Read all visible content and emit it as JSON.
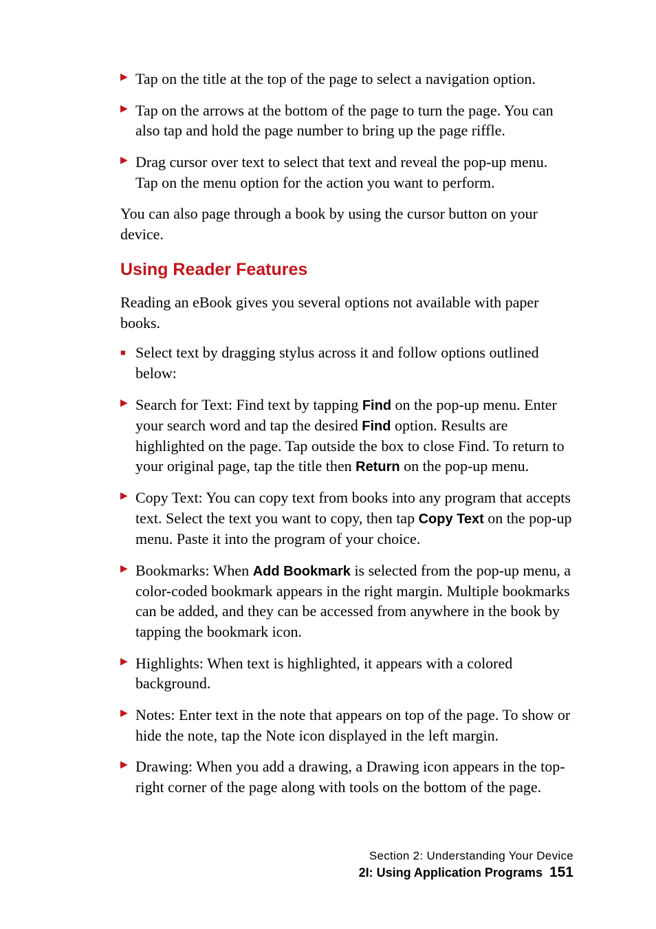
{
  "bullets_top": [
    "Tap on the title at the top of the page to select a navigation option.",
    "Tap on the arrows at the bottom of the page to turn the page. You can also tap and hold the page number to bring up the page riffle.",
    "Drag cursor over text to select that text and reveal the pop-up menu. Tap on the menu option for the action you want to perform."
  ],
  "para_after_top": "You can also page through a book by using the cursor button on your device.",
  "section_heading": "Using Reader Features",
  "intro_para": "Reading an eBook gives you several options not available with paper books.",
  "square_bullet": "Select text by dragging stylus across it and follow options outlined below:",
  "feature_bullets": {
    "search": {
      "pre1": "Search for Text: Find text by tapping ",
      "b1": "Find",
      "mid1": " on the pop-up menu. Enter your search word and tap the desired ",
      "b2": "Find",
      "mid2": " option. Results are highlighted on the page. Tap outside the box to close Find. To return to your original page, tap the title then ",
      "b3": "Return",
      "post": " on the pop-up menu."
    },
    "copy": {
      "pre": "Copy Text: You can copy text from books into any program that accepts text. Select the text you want to copy, then tap ",
      "b1": "Copy Text",
      "post": " on the pop-up menu. Paste it into the program of your choice."
    },
    "bookmarks": {
      "pre": "Bookmarks: When ",
      "b1": "Add Bookmark",
      "post": " is selected from the pop-up menu, a color-coded bookmark appears in the right margin. Multiple bookmarks can be added, and they can be accessed from anywhere in the book by tapping the bookmark icon."
    },
    "highlights": "Highlights: When text is highlighted, it appears with a colored background.",
    "notes": "Notes: Enter text in the note that appears on top of the page. To show or hide the note, tap the Note icon displayed in the left margin.",
    "drawing": "Drawing: When you add a drawing, a Drawing icon appears in the top-right corner of the page along with tools on the bottom of the page."
  },
  "footer": {
    "line1": "Section 2: Understanding Your Device",
    "line2_title": "2I: Using Application Programs",
    "page_num": "151"
  }
}
